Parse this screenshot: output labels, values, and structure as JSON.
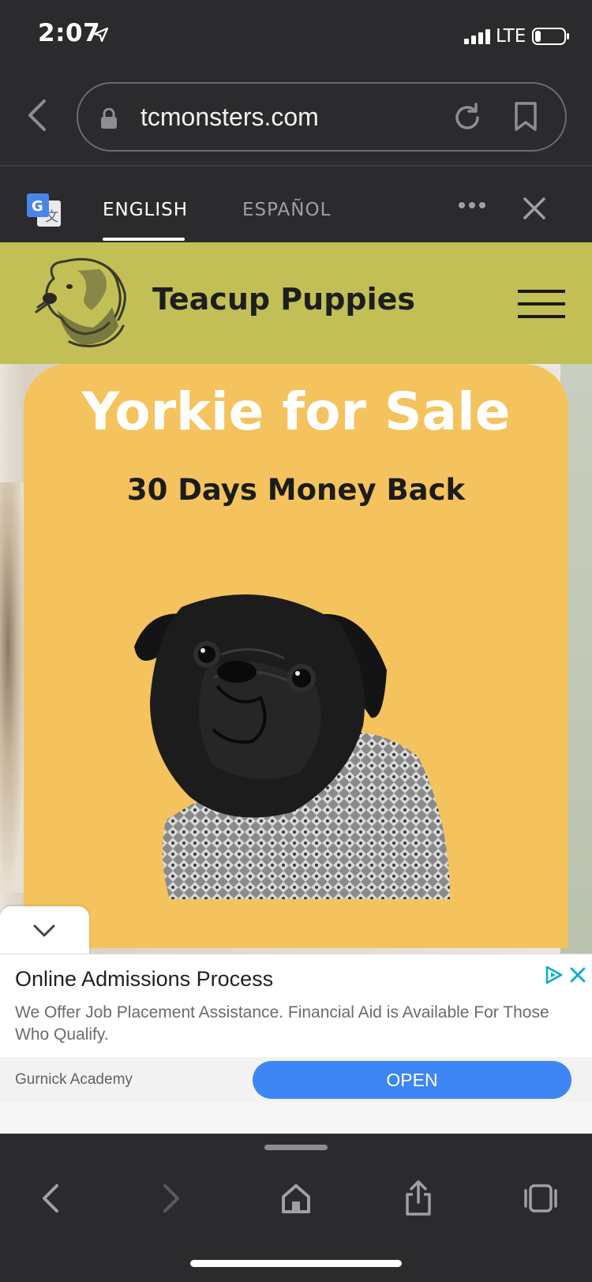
{
  "status_bar": {
    "time": "2:07",
    "network": "LTE",
    "battery_level": 0.2
  },
  "browser": {
    "url": "tcmonsters.com"
  },
  "translate_bar": {
    "tabs": [
      "ENGLISH",
      "ESPAÑOL"
    ],
    "active_tab": "ENGLISH"
  },
  "site": {
    "title": "Teacup Puppies",
    "header_color": "#c2bf57"
  },
  "hero": {
    "title": "Yorkie for Sale",
    "subtitle": "30 Days Money Back",
    "card_color": "#f4c35d"
  },
  "ad": {
    "title": "Online Admissions Process",
    "body": "We Offer Job Placement Assistance. Financial Aid is Available For Those Who Qualify.",
    "advertiser": "Gurnick Academy",
    "cta": "OPEN",
    "cta_color": "#3d86f4"
  },
  "icons": {
    "top": [
      "back-icon",
      "lock-icon",
      "reload-icon",
      "bookmark-icon"
    ],
    "translate": [
      "google-translate-icon",
      "more-icon",
      "close-icon"
    ],
    "toolbar": [
      "back-icon",
      "forward-icon",
      "home-icon",
      "share-icon",
      "tabs-icon"
    ]
  }
}
